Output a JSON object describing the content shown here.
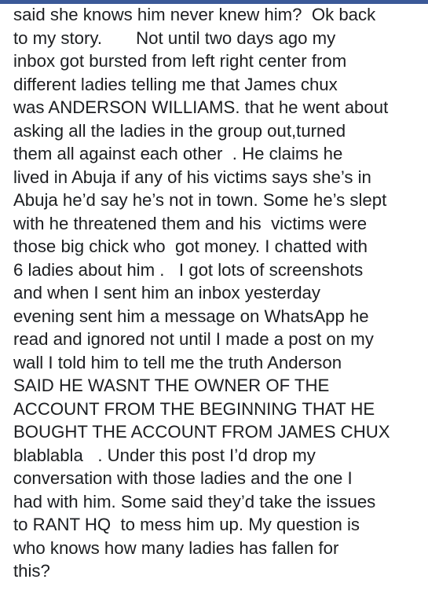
{
  "header": {
    "accent_color": "#3b5998"
  },
  "post": {
    "lines": [
      "said she knows him never knew him?  Ok back",
      "to my story.       Not until two days ago my",
      "inbox got bursted from left right center from",
      "different ladies telling me that James chux",
      "was ANDERSON WILLIAMS. that he went about",
      "asking all the ladies in the group out,turned",
      "them all against each other  . He claims he",
      "lived in Abuja if any of his victims says she’s in",
      "Abuja he’d say he’s not in town. Some he’s slept",
      "with he threatened them and his  victims were",
      "those big chick who  got money. I chatted with",
      "6 ladies about him .   I got lots of screenshots",
      "and when I sent him an inbox yesterday",
      "evening sent him a message on WhatsApp he",
      "read and ignored not until I made a post on my",
      "wall I told him to tell me the truth Anderson",
      "SAID HE WASNT THE OWNER OF THE",
      "ACCOUNT FROM THE BEGINNING THAT HE",
      "BOUGHT THE ACCOUNT FROM JAMES CHUX",
      "blablabla   . Under this post I’d drop my",
      "conversation with those ladies and the one I",
      "had with him. Some said they’d take the issues",
      "to RANT HQ  to mess him up. My question is",
      "who knows how many ladies has fallen for",
      "this?"
    ]
  }
}
